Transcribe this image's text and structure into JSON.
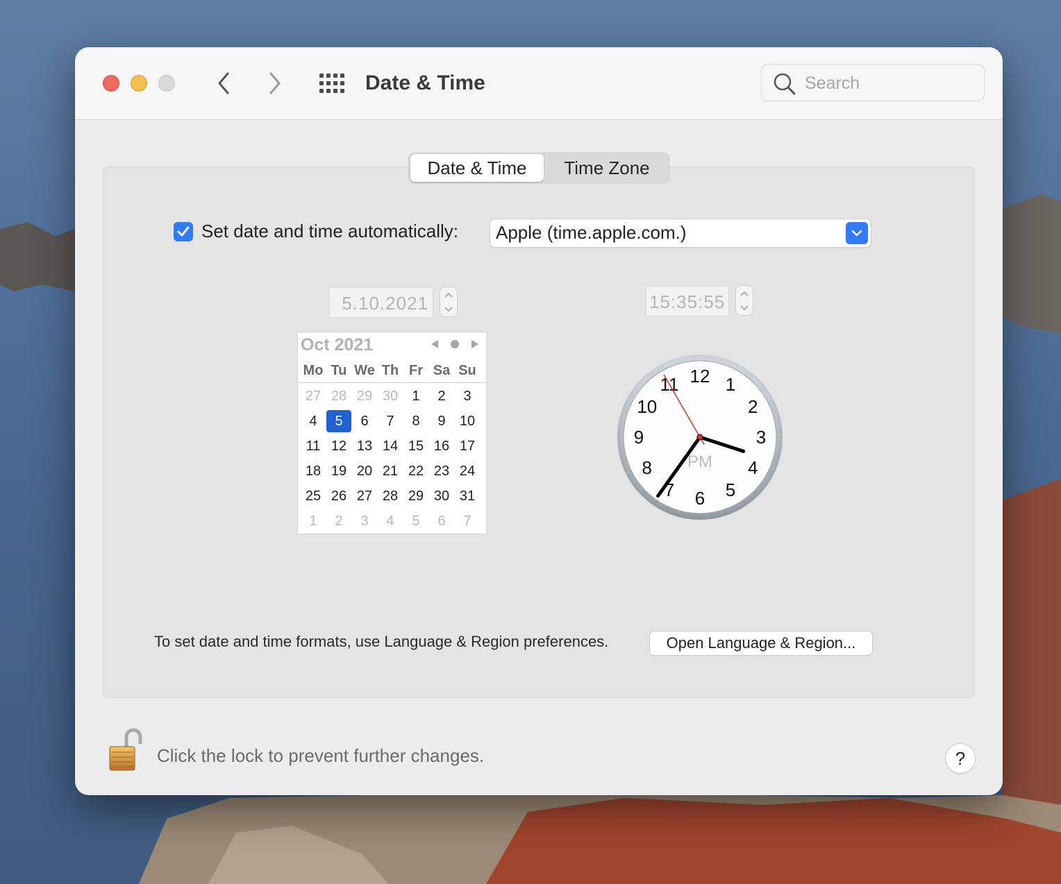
{
  "window": {
    "title": "Date & Time",
    "search_placeholder": "Search"
  },
  "tabs": [
    {
      "label": "Date & Time",
      "active": true
    },
    {
      "label": "Time Zone",
      "active": false
    }
  ],
  "auto_time": {
    "checked": true,
    "label": "Set date and time automatically:",
    "server": "Apple (time.apple.com.)"
  },
  "date_field": "5.10.2021",
  "time_field": "15:35:55",
  "calendar": {
    "month_label": "Oct 2021",
    "weekdays": [
      "Mo",
      "Tu",
      "We",
      "Th",
      "Fr",
      "Sa",
      "Su"
    ],
    "weeks": [
      [
        {
          "d": "27",
          "dim": true
        },
        {
          "d": "28",
          "dim": true
        },
        {
          "d": "29",
          "dim": true
        },
        {
          "d": "30",
          "dim": true
        },
        {
          "d": "1"
        },
        {
          "d": "2"
        },
        {
          "d": "3"
        }
      ],
      [
        {
          "d": "4"
        },
        {
          "d": "5",
          "selected": true
        },
        {
          "d": "6"
        },
        {
          "d": "7"
        },
        {
          "d": "8"
        },
        {
          "d": "9"
        },
        {
          "d": "10"
        }
      ],
      [
        {
          "d": "11"
        },
        {
          "d": "12"
        },
        {
          "d": "13"
        },
        {
          "d": "14"
        },
        {
          "d": "15"
        },
        {
          "d": "16"
        },
        {
          "d": "17"
        }
      ],
      [
        {
          "d": "18"
        },
        {
          "d": "19"
        },
        {
          "d": "20"
        },
        {
          "d": "21"
        },
        {
          "d": "22"
        },
        {
          "d": "23"
        },
        {
          "d": "24"
        }
      ],
      [
        {
          "d": "25"
        },
        {
          "d": "26"
        },
        {
          "d": "27"
        },
        {
          "d": "28"
        },
        {
          "d": "29"
        },
        {
          "d": "30"
        },
        {
          "d": "31"
        }
      ],
      [
        {
          "d": "1",
          "dim": true
        },
        {
          "d": "2",
          "dim": true
        },
        {
          "d": "3",
          "dim": true
        },
        {
          "d": "4",
          "dim": true
        },
        {
          "d": "5",
          "dim": true
        },
        {
          "d": "6",
          "dim": true
        },
        {
          "d": "7",
          "dim": true
        }
      ]
    ]
  },
  "clock": {
    "hour": 15,
    "minute": 35,
    "second": 55,
    "meridiem": "PM",
    "numerals": [
      "12",
      "1",
      "2",
      "3",
      "4",
      "5",
      "6",
      "7",
      "8",
      "9",
      "10",
      "11"
    ]
  },
  "format_hint": "To set date and time formats, use Language & Region preferences.",
  "open_region_button": "Open Language & Region...",
  "lock_text": "Click the lock to prevent further changes.",
  "help_label": "?",
  "colors": {
    "accent": "#2f7cf6",
    "selected_day": "#2160d3",
    "second_hand": "#e0321e"
  }
}
